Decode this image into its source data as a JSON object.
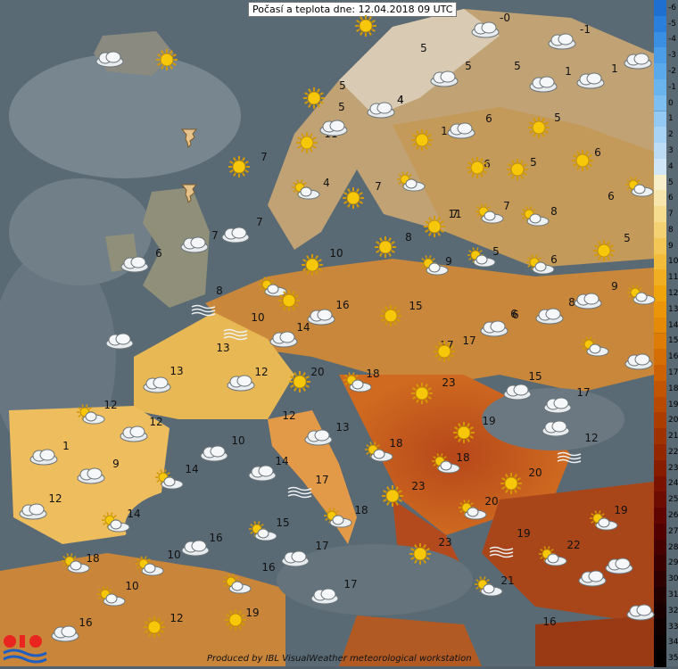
{
  "title": "Počasí a teplota dne: 12.04.2018 09 UTC",
  "credit": "Produced by IBL VisualWeather meteorological workstation",
  "scale": {
    "labels": [
      "-6",
      "-5",
      "-4",
      "-3",
      "-2",
      "-1",
      "0",
      "1",
      "2",
      "3",
      "4",
      "5",
      "6",
      "7",
      "8",
      "9",
      "10",
      "11",
      "12",
      "13",
      "14",
      "15",
      "16",
      "17",
      "18",
      "19",
      "20",
      "21",
      "22",
      "23",
      "24",
      "25",
      "26",
      "27",
      "28",
      "29",
      "30",
      "31",
      "32",
      "33",
      "34",
      "35"
    ],
    "colors": [
      "#1e6fd0",
      "#2b7fdc",
      "#3a8fe2",
      "#4a9de6",
      "#5aa9ea",
      "#6ab4ee",
      "#7ebff1",
      "#93c9f3",
      "#a8d3f5",
      "#bcdcf6",
      "#cfe5f8",
      "#f7efcc",
      "#f6e6ad",
      "#f5dc8f",
      "#f4d172",
      "#f3c655",
      "#f2bb3a",
      "#f0af22",
      "#efa30c",
      "#eb960a",
      "#e48a08",
      "#dd7c06",
      "#d56f05",
      "#cc6204",
      "#c25503",
      "#b74902",
      "#ab3d01",
      "#9f3201",
      "#932700",
      "#861d00",
      "#7a1400",
      "#6d0c00",
      "#600500",
      "#530000",
      "#460000",
      "#3a0000",
      "#2e0000",
      "#230000",
      "#180000",
      "#0e0000",
      "#080000",
      "#000000"
    ]
  },
  "temperatures": [
    "-0",
    "-1",
    "5",
    "5",
    "5",
    "1",
    "1",
    "4",
    "5",
    "5",
    "4",
    "6",
    "5",
    "1",
    "6",
    "5",
    "11",
    "6",
    "7",
    "7",
    "6",
    "4",
    "7",
    "7",
    "8",
    "6",
    "5",
    "8",
    "11",
    "6",
    "5",
    "7",
    "7",
    "9",
    "6",
    "10",
    "9",
    "6",
    "8",
    "16",
    "15",
    "8",
    "10",
    "14",
    "13",
    "17",
    "13",
    "12",
    "20",
    "18",
    "17",
    "15",
    "17",
    "23",
    "12",
    "12",
    "13",
    "19",
    "12",
    "1",
    "10",
    "18",
    "9",
    "14",
    "18",
    "14",
    "20",
    "12",
    "17",
    "23",
    "20",
    "19",
    "12",
    "18",
    "14",
    "15",
    "19",
    "18",
    "16",
    "16",
    "17",
    "23",
    "22",
    "10",
    "16",
    "21",
    "10",
    "17",
    "16",
    "19",
    "12"
  ],
  "icons": [
    "cloud",
    "cloud-rain",
    "sun",
    "sun",
    "sun-cloud",
    "tornado",
    "sun",
    "sun-cloud",
    "sun",
    "cloud",
    "cloud",
    "cloud",
    "sun-cloud",
    "fog"
  ]
}
